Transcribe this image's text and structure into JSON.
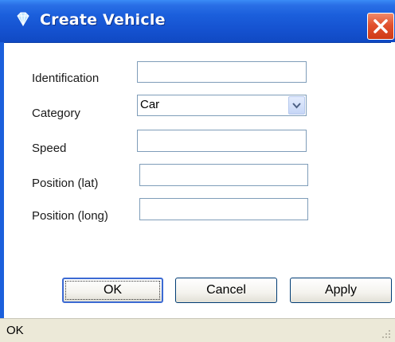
{
  "window": {
    "title": "Create Vehicle"
  },
  "form": {
    "identification_label": "Identification",
    "identification_value": "",
    "category_label": "Category",
    "category_value": "Car",
    "speed_label": "Speed",
    "speed_value": "",
    "lat_label": "Position (lat)",
    "lat_value": "",
    "long_label": "Position (long)",
    "long_value": ""
  },
  "buttons": {
    "ok": "OK",
    "cancel": "Cancel",
    "apply": "Apply"
  },
  "status": {
    "text": "OK"
  },
  "icons": {
    "title": "gem-icon",
    "close": "close-icon",
    "dropdown": "chevron-down-icon",
    "grip": "resize-grip-icon"
  },
  "colors": {
    "titlebar": "#1b5fdc",
    "close": "#e1512e",
    "window_bg": "#ece9d8"
  }
}
